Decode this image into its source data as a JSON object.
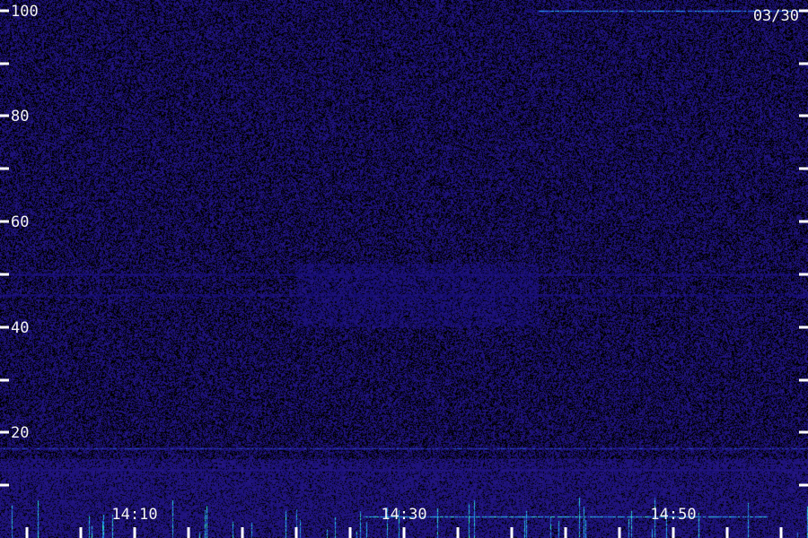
{
  "date_label": "03/30",
  "chart_data": {
    "type": "heatmap",
    "title": "",
    "xlabel": "",
    "ylabel": "",
    "ylim": [
      0,
      102
    ],
    "xlim": [
      "14:00",
      "15:00"
    ],
    "y_ticks_labeled": [
      100,
      80,
      60,
      40,
      20
    ],
    "y_ticks_all": [
      10,
      20,
      30,
      40,
      50,
      60,
      70,
      80,
      90,
      100
    ],
    "x_ticks_labeled": [
      "14:10",
      "14:30",
      "14:50"
    ],
    "x_ticks_all": [
      "14:02",
      "14:06",
      "14:10",
      "14:14",
      "14:18",
      "14:22",
      "14:26",
      "14:30",
      "14:34",
      "14:38",
      "14:42",
      "14:46",
      "14:50",
      "14:54",
      "14:58"
    ],
    "colors": {
      "background": "#000000",
      "noise": "#2a1a8a",
      "signal_low": "#1aa0ff",
      "signal_high": "#40ffb0",
      "axis": "#ffffff"
    },
    "features": [
      {
        "kind": "line",
        "y": 100,
        "x_start": "14:40",
        "x_end": "15:00",
        "intensity": 0.9
      },
      {
        "kind": "line",
        "y": 100,
        "x_start": "14:39",
        "x_end": "14:40",
        "intensity": 0.4
      },
      {
        "kind": "line",
        "y": 50,
        "x_start": "14:00",
        "x_end": "15:00",
        "intensity": 0.35
      },
      {
        "kind": "line",
        "y": 46,
        "x_start": "14:00",
        "x_end": "15:00",
        "intensity": 0.25
      },
      {
        "kind": "line",
        "y": 17,
        "x_start": "14:00",
        "x_end": "15:00",
        "intensity": 0.7
      },
      {
        "kind": "line",
        "y": 13,
        "x_start": "14:00",
        "x_end": "15:00",
        "intensity": 0.55
      },
      {
        "kind": "line",
        "y": 4,
        "x_start": "14:27",
        "x_end": "14:57",
        "intensity": 1.0
      },
      {
        "kind": "band",
        "y_start": 0,
        "y_end": 15,
        "x_start": "14:00",
        "x_end": "15:00",
        "intensity": 0.55
      },
      {
        "kind": "patch",
        "y_start": 40,
        "y_end": 52,
        "x_start": "14:22",
        "x_end": "14:40",
        "intensity": 0.3
      }
    ]
  }
}
